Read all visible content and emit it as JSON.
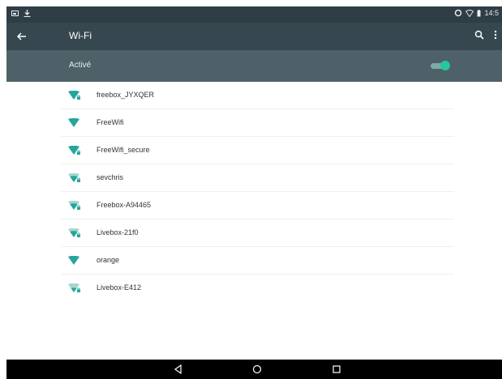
{
  "colors": {
    "statusbar": "#2f3d45",
    "appbar": "#37474f",
    "master_bar": "#4f6168",
    "accent": "#26c6a0",
    "wifi_icon": "#26a69a"
  },
  "status_bar": {
    "time": "14:5",
    "icons": [
      "image-icon",
      "download-icon",
      "sync-icon",
      "wifi-status-icon",
      "battery-icon"
    ]
  },
  "app_bar": {
    "title": "Wi-Fi",
    "icons": [
      "back-arrow-icon",
      "search-icon",
      "overflow-menu-icon"
    ]
  },
  "master_switch": {
    "label": "Activé",
    "enabled": true
  },
  "networks": [
    {
      "ssid": "freebox_JYXQER",
      "secured": true
    },
    {
      "ssid": "FreeWifi",
      "secured": false
    },
    {
      "ssid": "FreeWifi_secure",
      "secured": true
    },
    {
      "ssid": "sevchris",
      "secured": true
    },
    {
      "ssid": "Freebox-A94465",
      "secured": true
    },
    {
      "ssid": "Livebox-21f0",
      "secured": true
    },
    {
      "ssid": "orange",
      "secured": false
    },
    {
      "ssid": "Livebox-E412",
      "secured": true
    }
  ],
  "nav_bar": {
    "icons": [
      "back-triangle-icon",
      "home-circle-icon",
      "recents-square-icon"
    ]
  }
}
